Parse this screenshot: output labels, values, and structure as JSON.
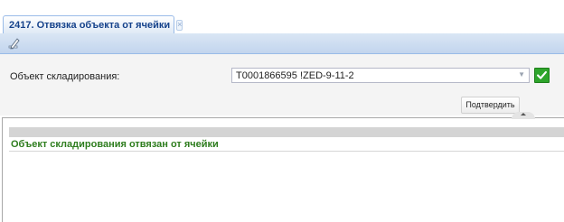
{
  "tab": {
    "title": "2417. Отвязка объекта от ячейки",
    "close_glyph": "×"
  },
  "toolbar": {
    "icons": [
      "edit-icon"
    ]
  },
  "form": {
    "storage_object_label": "Объект складирования:",
    "storage_object_value": "T0001866595 !ZED-9-11-2",
    "confirm_label": "Подтвердить"
  },
  "result": {
    "message": "Объект складирования отвязан от ячейки"
  },
  "colors": {
    "tab_title": "#15428b",
    "toolbar_bg": "#c2d5ee",
    "success_text": "#2e7d1e",
    "check_button": "#2ea52b"
  }
}
